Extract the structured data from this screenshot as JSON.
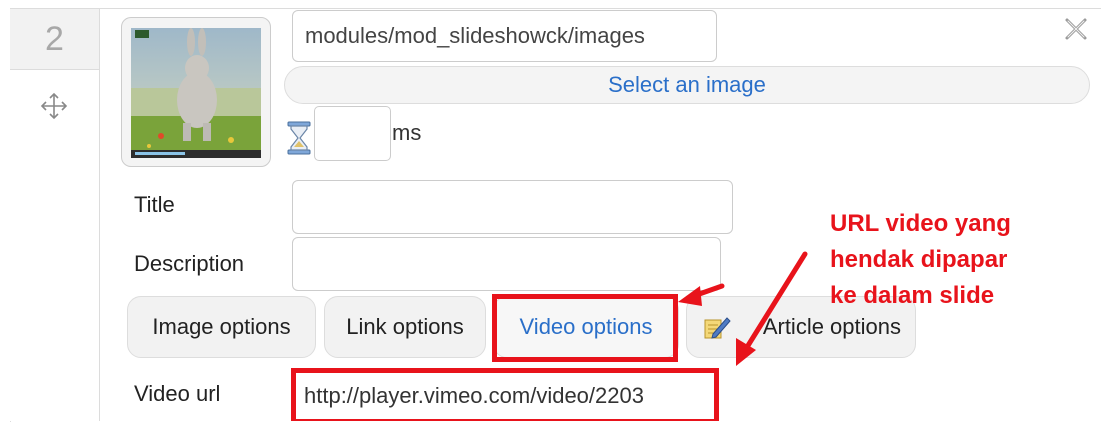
{
  "slide": {
    "number": "2",
    "image_path": "modules/mod_slideshowck/images",
    "select_image_label": "Select an image",
    "duration_value": "",
    "duration_unit": "ms"
  },
  "fields": {
    "title_label": "Title",
    "title_value": "",
    "description_label": "Description",
    "description_value": ""
  },
  "tabs": [
    {
      "label": "Image options",
      "active": false
    },
    {
      "label": "Link options",
      "active": false
    },
    {
      "label": "Video options",
      "active": true
    },
    {
      "label": "Article options",
      "active": false
    }
  ],
  "video": {
    "label": "Video url",
    "value": "http://player.vimeo.com/video/2203"
  },
  "annotation": {
    "lines": [
      "URL video yang",
      "hendak dipapar",
      "ke dalam slide"
    ],
    "color": "#e8131b"
  },
  "colors": {
    "link_blue": "#2a6fc9",
    "highlight_red": "#e8131b"
  },
  "icons": [
    "move-icon",
    "hourglass-icon",
    "close-icon",
    "article-edit-icon"
  ]
}
